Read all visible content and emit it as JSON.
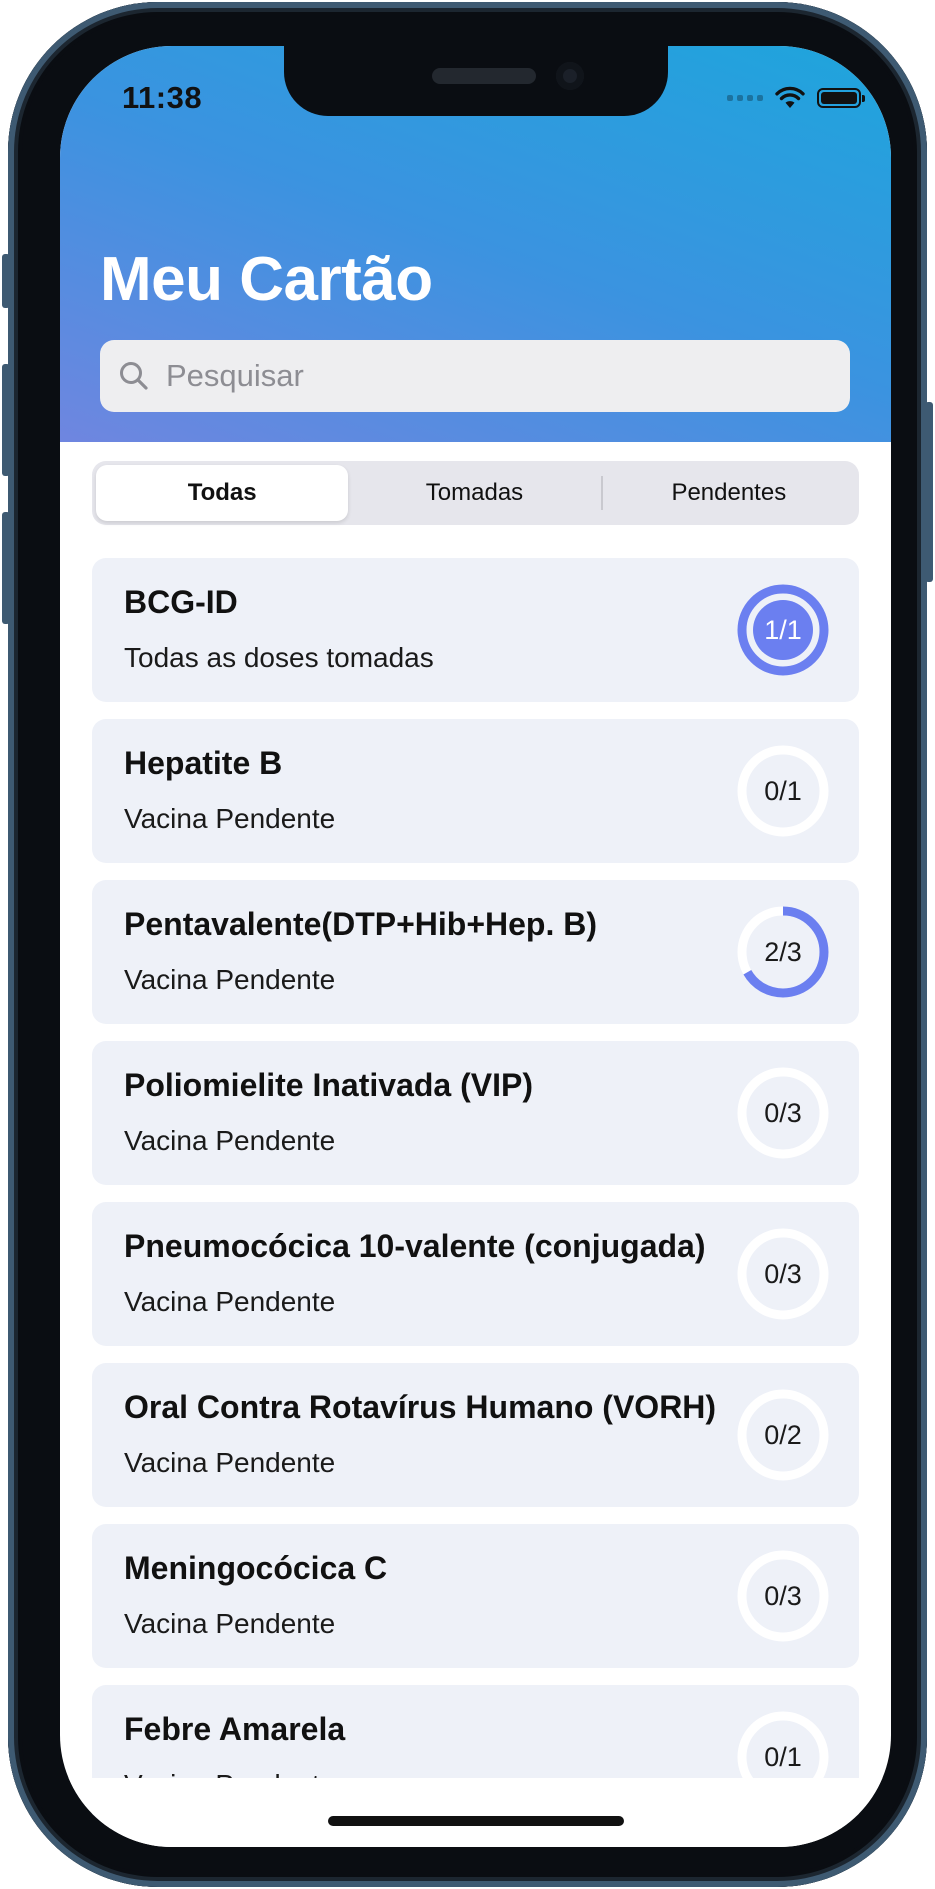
{
  "status_bar": {
    "time": "11:38"
  },
  "header": {
    "title": "Meu Cartão",
    "search": {
      "placeholder": "Pesquisar",
      "value": ""
    }
  },
  "tabs": [
    {
      "label": "Todas",
      "selected": true
    },
    {
      "label": "Tomadas",
      "selected": false
    },
    {
      "label": "Pendentes",
      "selected": false
    }
  ],
  "colors": {
    "accent": "#6b7ff0",
    "header_start": "#1ea5dc",
    "header_end": "#6f86e0",
    "card_bg": "#eef1f8"
  },
  "vaccines": [
    {
      "name": "BCG-ID",
      "status": "Todas as doses tomadas",
      "taken": 1,
      "total": 1,
      "progress_label": "1/1"
    },
    {
      "name": "Hepatite B",
      "status": "Vacina Pendente",
      "taken": 0,
      "total": 1,
      "progress_label": "0/1"
    },
    {
      "name": "Pentavalente(DTP+Hib+Hep. B)",
      "status": "Vacina Pendente",
      "taken": 2,
      "total": 3,
      "progress_label": "2/3"
    },
    {
      "name": "Poliomielite Inativada (VIP)",
      "status": "Vacina Pendente",
      "taken": 0,
      "total": 3,
      "progress_label": "0/3"
    },
    {
      "name": "Pneumocócica 10-valente (conjugada)",
      "status": "Vacina Pendente",
      "taken": 0,
      "total": 3,
      "progress_label": "0/3"
    },
    {
      "name": "Oral Contra Rotavírus Humano (VORH)",
      "status": "Vacina Pendente",
      "taken": 0,
      "total": 2,
      "progress_label": "0/2"
    },
    {
      "name": "Meningocócica C",
      "status": "Vacina Pendente",
      "taken": 0,
      "total": 3,
      "progress_label": "0/3"
    },
    {
      "name": "Febre Amarela",
      "status": "Vacina Pendente",
      "taken": 0,
      "total": 1,
      "progress_label": "0/1"
    }
  ]
}
